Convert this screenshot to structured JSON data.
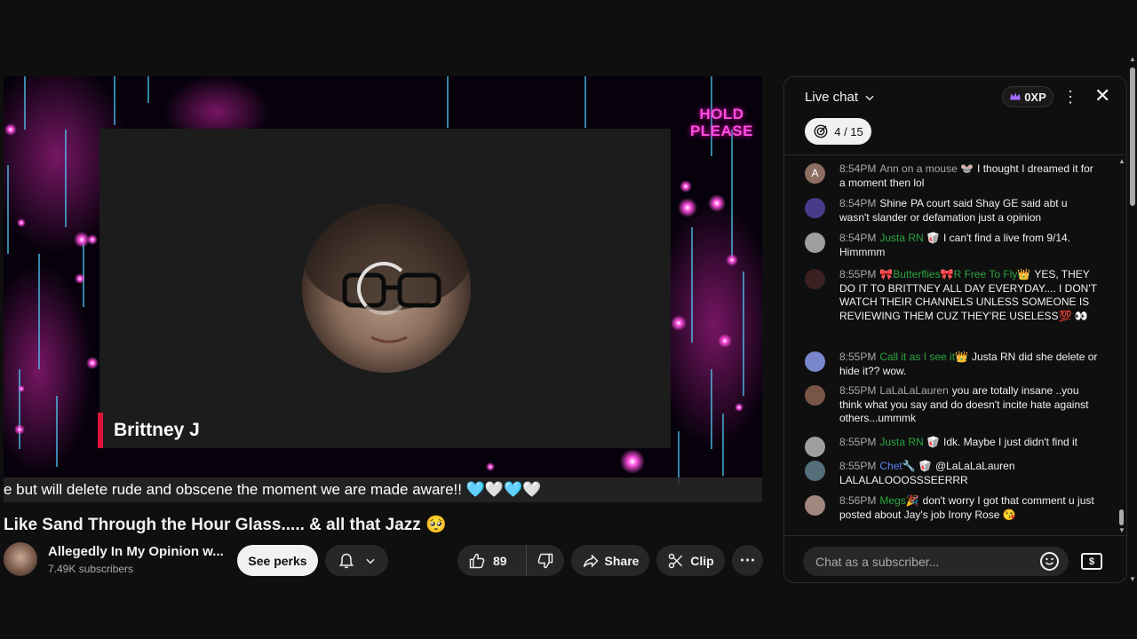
{
  "video": {
    "overlay_top_right": [
      "HOLD",
      "PLEASE"
    ],
    "name_tag": "Brittney J",
    "ticker_text": "e but will delete rude and obscene the moment we are made aware!! 🩵🤍🩵🤍",
    "accent_colors": {
      "neon_pink": "#ff4fe0",
      "name_bar": "#e0123c",
      "neon_blue": "#4fd2ff"
    }
  },
  "title": "Like Sand Through the Hour Glass..... & all that Jazz 🥺",
  "channel": {
    "name": "Allegedly In My Opinion w...",
    "subscribers": "7.49K subscribers",
    "perks_label": "See perks",
    "bell_icon": "bell-icon"
  },
  "actions": {
    "like_count": "89",
    "share_label": "Share",
    "clip_label": "Clip",
    "more_label": "⋯"
  },
  "chat": {
    "title": "Live chat",
    "xp": "0XP",
    "goal": "4 / 15",
    "input_placeholder": "Chat as a subscriber...",
    "messages": [
      {
        "time": "8:54PM",
        "author": "Ann on a mouse 🐭",
        "author_style": "",
        "text": "I thought I dreamed it for a moment then lol",
        "avatar_color": "#8d6e63",
        "avatar_letter": "A"
      },
      {
        "time": "8:54PM",
        "author": "Shine",
        "author_style": "",
        "text": "PA court said Shay GE said abt u wasn't slander or defamation just a opinion",
        "avatar_color": "#4a3a8a",
        "avatar_letter": ""
      },
      {
        "time": "8:54PM",
        "author": "Justa RN 🥡",
        "author_style": "green",
        "text": "I can't find a live from 9/14. Himmmm",
        "avatar_color": "#9e9e9e",
        "avatar_letter": ""
      },
      {
        "time": "8:55PM",
        "author": "🎀Butterflies🎀R Free To Fly👑",
        "author_style": "green",
        "text": "YES, THEY DO IT TO BRITTNEY ALL DAY EVERYDAY.... I DON'T WATCH THEIR CHANNELS UNLESS SOMEONE IS REVIEWING THEM CUZ THEY'RE USELESS💯 👀",
        "avatar_color": "#3a2020",
        "avatar_letter": ""
      },
      {
        "time": "8:55PM",
        "author": "Call it as I see it👑",
        "author_style": "green",
        "text": "Justa RN did she delete or hide it?? wow.",
        "avatar_color": "#7986cb",
        "avatar_letter": ""
      },
      {
        "time": "8:55PM",
        "author": "LaLaLaLauren",
        "author_style": "",
        "text": "you are totally insane ..you think what you say and do doesn't incite hate against others...ummmk",
        "avatar_color": "#795548",
        "avatar_letter": ""
      },
      {
        "time": "8:55PM",
        "author": "Justa RN 🥡",
        "author_style": "green",
        "text": "Idk. Maybe I just didn't find it",
        "avatar_color": "#9e9e9e",
        "avatar_letter": ""
      },
      {
        "time": "8:55PM",
        "author": "Chet🔧 🥡",
        "author_style": "blue",
        "text": "@LaLaLaLauren LALALALOOOSSSEERRR",
        "avatar_color": "#546e7a",
        "avatar_letter": ""
      },
      {
        "time": "8:56PM",
        "author": "Megs🎉",
        "author_style": "green",
        "text": "don't worry I got that comment u just posted about Jay's job Irony Rose 😘",
        "avatar_color": "#a1887f",
        "avatar_letter": ""
      }
    ]
  }
}
